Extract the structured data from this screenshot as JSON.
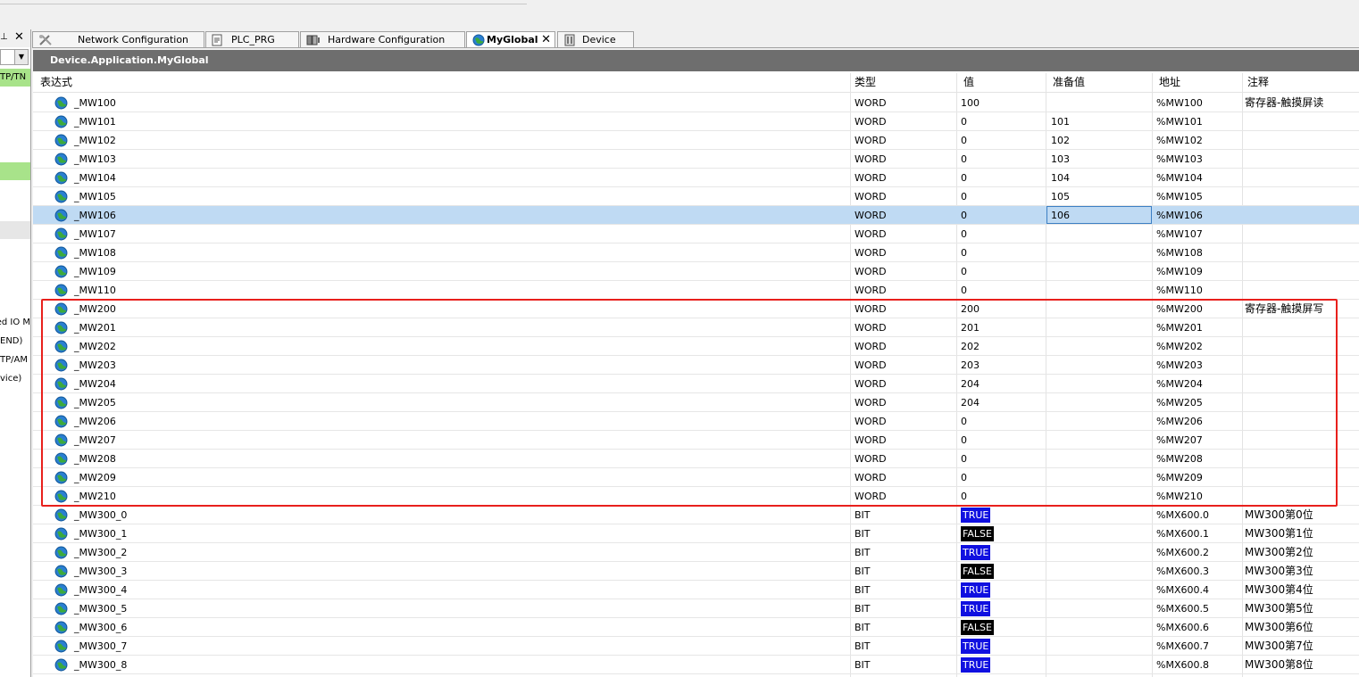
{
  "left_panel": {
    "rows": [
      {
        "text": "TP/TN",
        "style": "green"
      },
      {
        "text": "",
        "style": "green"
      },
      {
        "text": "",
        "style": "grey"
      },
      {
        "text": "ed IO M",
        "style": ""
      },
      {
        "text": "END)",
        "style": ""
      },
      {
        "text": "TP/AM",
        "style": ""
      },
      {
        "text": "vice)",
        "style": ""
      }
    ]
  },
  "tabs": [
    {
      "label": "Network Configuration",
      "icon": "network-config-icon"
    },
    {
      "label": "PLC_PRG",
      "icon": "document-icon"
    },
    {
      "label": "Hardware Configuration",
      "icon": "hardware-icon"
    },
    {
      "label": "MyGlobal",
      "icon": "globe-icon",
      "active": true
    },
    {
      "label": "Device",
      "icon": "device-icon"
    }
  ],
  "editor": {
    "title": "Device.Application.MyGlobal",
    "columns": {
      "expression": "表达式",
      "type": "类型",
      "value": "值",
      "prepared": "准备值",
      "address": "地址",
      "comment": "注释"
    },
    "rows": [
      {
        "name": "_MW100",
        "type": "WORD",
        "value": "100",
        "prepared": "",
        "address": "%MW100",
        "comment": "寄存器-触摸屏读"
      },
      {
        "name": "_MW101",
        "type": "WORD",
        "value": "0",
        "prepared": "101",
        "address": "%MW101",
        "comment": ""
      },
      {
        "name": "_MW102",
        "type": "WORD",
        "value": "0",
        "prepared": "102",
        "address": "%MW102",
        "comment": ""
      },
      {
        "name": "_MW103",
        "type": "WORD",
        "value": "0",
        "prepared": "103",
        "address": "%MW103",
        "comment": ""
      },
      {
        "name": "_MW104",
        "type": "WORD",
        "value": "0",
        "prepared": "104",
        "address": "%MW104",
        "comment": ""
      },
      {
        "name": "_MW105",
        "type": "WORD",
        "value": "0",
        "prepared": "105",
        "address": "%MW105",
        "comment": ""
      },
      {
        "name": "_MW106",
        "type": "WORD",
        "value": "0",
        "prepared": "106",
        "address": "%MW106",
        "comment": "",
        "selected": true
      },
      {
        "name": "_MW107",
        "type": "WORD",
        "value": "0",
        "prepared": "",
        "address": "%MW107",
        "comment": ""
      },
      {
        "name": "_MW108",
        "type": "WORD",
        "value": "0",
        "prepared": "",
        "address": "%MW108",
        "comment": ""
      },
      {
        "name": "_MW109",
        "type": "WORD",
        "value": "0",
        "prepared": "",
        "address": "%MW109",
        "comment": ""
      },
      {
        "name": "_MW110",
        "type": "WORD",
        "value": "0",
        "prepared": "",
        "address": "%MW110",
        "comment": ""
      },
      {
        "name": "_MW200",
        "type": "WORD",
        "value": "200",
        "prepared": "",
        "address": "%MW200",
        "comment": "寄存器-触摸屏写"
      },
      {
        "name": "_MW201",
        "type": "WORD",
        "value": "201",
        "prepared": "",
        "address": "%MW201",
        "comment": ""
      },
      {
        "name": "_MW202",
        "type": "WORD",
        "value": "202",
        "prepared": "",
        "address": "%MW202",
        "comment": ""
      },
      {
        "name": "_MW203",
        "type": "WORD",
        "value": "203",
        "prepared": "",
        "address": "%MW203",
        "comment": ""
      },
      {
        "name": "_MW204",
        "type": "WORD",
        "value": "204",
        "prepared": "",
        "address": "%MW204",
        "comment": ""
      },
      {
        "name": "_MW205",
        "type": "WORD",
        "value": "204",
        "prepared": "",
        "address": "%MW205",
        "comment": ""
      },
      {
        "name": "_MW206",
        "type": "WORD",
        "value": "0",
        "prepared": "",
        "address": "%MW206",
        "comment": ""
      },
      {
        "name": "_MW207",
        "type": "WORD",
        "value": "0",
        "prepared": "",
        "address": "%MW207",
        "comment": ""
      },
      {
        "name": "_MW208",
        "type": "WORD",
        "value": "0",
        "prepared": "",
        "address": "%MW208",
        "comment": ""
      },
      {
        "name": "_MW209",
        "type": "WORD",
        "value": "0",
        "prepared": "",
        "address": "%MW209",
        "comment": ""
      },
      {
        "name": "_MW210",
        "type": "WORD",
        "value": "0",
        "prepared": "",
        "address": "%MW210",
        "comment": ""
      },
      {
        "name": "_MW300_0",
        "type": "BIT",
        "value": "TRUE",
        "prepared": "",
        "address": "%MX600.0",
        "comment": "MW300第0位"
      },
      {
        "name": "_MW300_1",
        "type": "BIT",
        "value": "FALSE",
        "prepared": "",
        "address": "%MX600.1",
        "comment": "MW300第1位"
      },
      {
        "name": "_MW300_2",
        "type": "BIT",
        "value": "TRUE",
        "prepared": "",
        "address": "%MX600.2",
        "comment": "MW300第2位"
      },
      {
        "name": "_MW300_3",
        "type": "BIT",
        "value": "FALSE",
        "prepared": "",
        "address": "%MX600.3",
        "comment": "MW300第3位"
      },
      {
        "name": "_MW300_4",
        "type": "BIT",
        "value": "TRUE",
        "prepared": "",
        "address": "%MX600.4",
        "comment": "MW300第4位"
      },
      {
        "name": "_MW300_5",
        "type": "BIT",
        "value": "TRUE",
        "prepared": "",
        "address": "%MX600.5",
        "comment": "MW300第5位"
      },
      {
        "name": "_MW300_6",
        "type": "BIT",
        "value": "FALSE",
        "prepared": "",
        "address": "%MX600.6",
        "comment": "MW300第6位"
      },
      {
        "name": "_MW300_7",
        "type": "BIT",
        "value": "TRUE",
        "prepared": "",
        "address": "%MX600.7",
        "comment": "MW300第7位"
      },
      {
        "name": "_MW300_8",
        "type": "BIT",
        "value": "TRUE",
        "prepared": "",
        "address": "%MX600.8",
        "comment": "MW300第8位"
      }
    ]
  },
  "colors": {
    "true_badge": "#1010e0",
    "false_badge": "#000000",
    "selection": "#bfdaf3",
    "highlight_box": "#e8201c",
    "title_bar": "#6e6e6e",
    "status_green": "#a8e38a"
  }
}
